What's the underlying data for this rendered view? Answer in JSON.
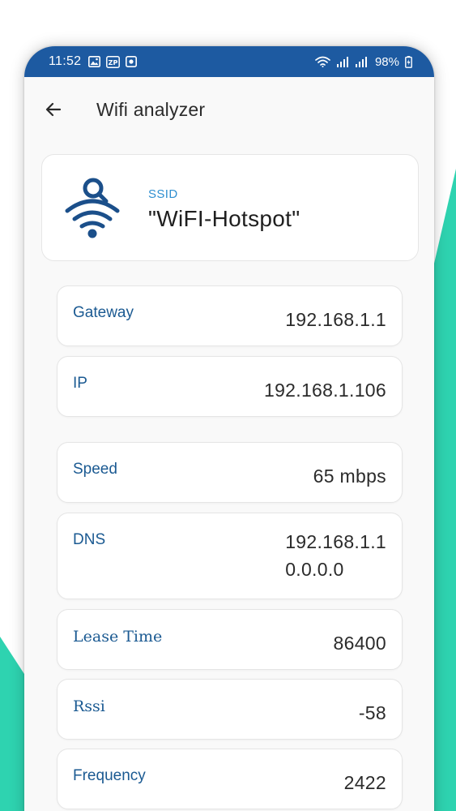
{
  "status_bar": {
    "time": "11:52",
    "battery": "98%",
    "left_icons": [
      "gallery-icon",
      "zp-badge-icon",
      "app-notification-icon"
    ],
    "zp_badge": "ZP",
    "right_icons": [
      "wifi-icon",
      "signal-icon",
      "signal-icon",
      "battery-icon"
    ]
  },
  "app_bar": {
    "title": "Wifi analyzer",
    "back_icon": "arrow-left-icon"
  },
  "ssid": {
    "label": "SSID",
    "value": "\"WiFI-Hotspot\"",
    "icon": "wifi-search-icon"
  },
  "info_rows": [
    {
      "label": "Gateway",
      "value": "192.168.1.1"
    },
    {
      "label": "IP",
      "value": "192.168.1.106"
    },
    {
      "label": "Speed",
      "value": "65 mbps"
    },
    {
      "label": "DNS",
      "values": [
        "192.168.1.1",
        "0.0.0.0"
      ]
    },
    {
      "label": "Lease Time",
      "value": "86400"
    },
    {
      "label": "Rssi",
      "value": "-58"
    },
    {
      "label": "Frequency",
      "value": "2422"
    }
  ],
  "colors": {
    "status_bar": "#1d5aa1",
    "accent_teal": "#2ed3b0",
    "label_blue": "#1b5a92",
    "ssid_label": "#2f8fd0",
    "icon_navy": "#1b4f8a"
  }
}
